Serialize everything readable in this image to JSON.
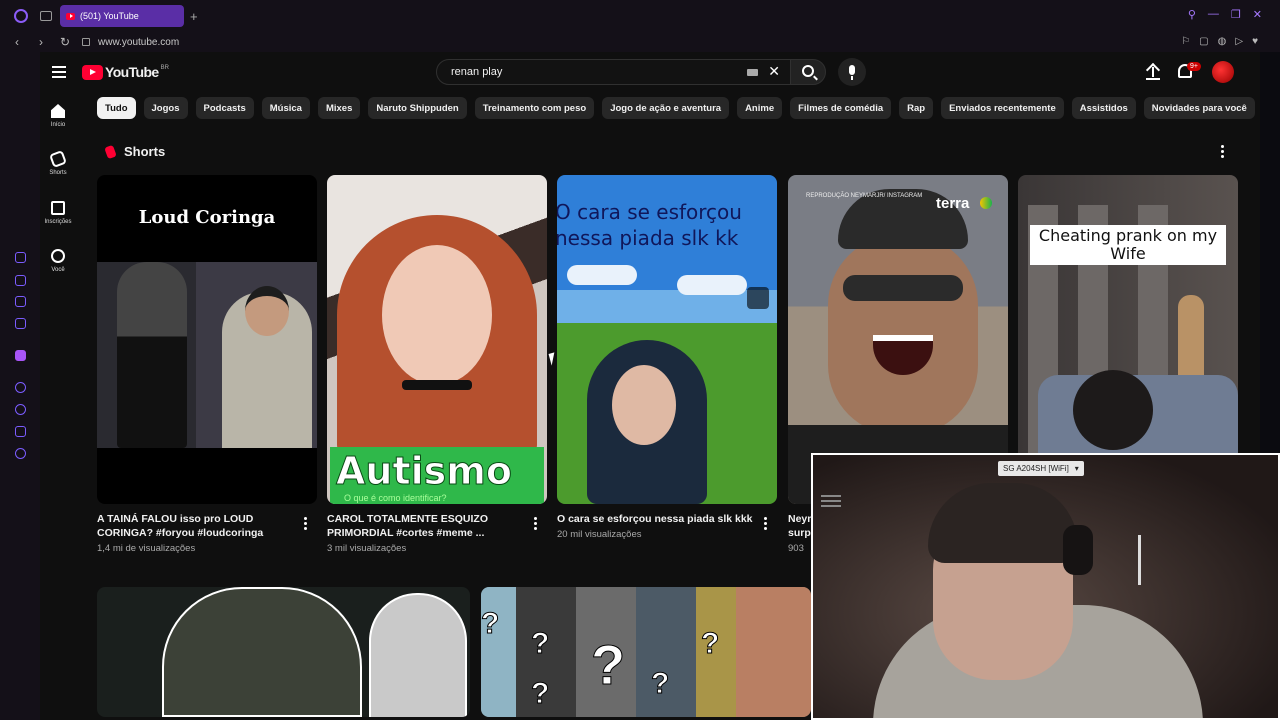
{
  "browser": {
    "tab_title": "(501) YouTube",
    "url": "www.youtube.com",
    "new_tab": "+"
  },
  "youtube": {
    "logo_text": "YouTube",
    "logo_country": "BR",
    "search_value": "renan play",
    "notification_badge": "9+",
    "guide": [
      {
        "label": "Início",
        "icon": "home-icon"
      },
      {
        "label": "Shorts",
        "icon": "shorts-icon"
      },
      {
        "label": "Inscrições",
        "icon": "subscriptions-icon"
      },
      {
        "label": "Você",
        "icon": "you-icon"
      }
    ],
    "chips": [
      "Tudo",
      "Jogos",
      "Podcasts",
      "Música",
      "Mixes",
      "Naruto Shippuden",
      "Treinamento com peso",
      "Jogo de ação e aventura",
      "Anime",
      "Filmes de comédia",
      "Rap",
      "Enviados recentemente",
      "Assistidos",
      "Novidades para você"
    ],
    "shorts_heading": "Shorts",
    "shorts": [
      {
        "title": "A TAINÁ FALOU isso pro LOUD CORINGA? #foryou #loudcoringa",
        "views": "1,4 mi de visualizações",
        "thumb_caption": "Loud Coringa"
      },
      {
        "title": "CAROL TOTALMENTE ESQUIZO PRIMORDIAL #cortes #meme ...",
        "views": "3 mil visualizações",
        "thumb_caption": "Autismo",
        "thumb_subcaption": "O que é como identificar?"
      },
      {
        "title": "O cara se esforçou nessa piada slk kkk",
        "views": "20 mil visualizações",
        "thumb_caption": "O cara se esforçou nessa piada slk kk"
      },
      {
        "title": "Neymar",
        "title_line2": "surp",
        "views": "903",
        "thumb_credit": "REPRODUÇÃO NEYMARJR/ INSTAGRAM",
        "thumb_brand": "terra"
      },
      {
        "title": "",
        "views": "",
        "thumb_caption": "Cheating prank on my Wife"
      }
    ]
  },
  "webcam": {
    "wifi_label": "SG A204SH [WiFi]"
  },
  "colors": {
    "yt_red": "#ff0033",
    "opera_purple": "#5a2ea6",
    "background": "#0f0f0f"
  }
}
